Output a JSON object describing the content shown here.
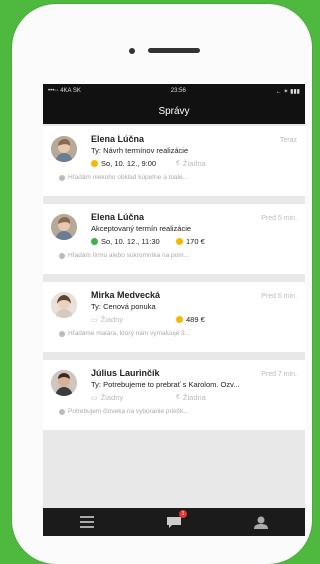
{
  "status_bar": {
    "carrier": "•••◦◦ 4KA SK",
    "time": "23:56",
    "right": "← ✶ ▮▮▮"
  },
  "nav": {
    "title": "Správy"
  },
  "messages": [
    {
      "name": "Elena Lúčna",
      "time": "Teraz",
      "subject": "Ty: Návrh termínov realizácie",
      "date": "So, 10. 12., 9:00",
      "date_status_color": "#f5b800",
      "price": "Žiadna",
      "price_muted": true,
      "preview": "Hľadám niekoho obklad kúpeľne a toale..."
    },
    {
      "name": "Elena Lúčna",
      "time": "Pred 5 min.",
      "subject": "Akceptovaný termín realizácie",
      "date": "So, 10. 12., 11:30",
      "date_status_color": "#3fb34a",
      "price": "170 €",
      "price_muted": false,
      "preview": "Hľadám firmu alebo súkromníka na pom..."
    },
    {
      "name": "Mirka Medvecká",
      "time": "Pred 6 min.",
      "subject": "Ty: Cenová ponuka",
      "date": "Žiadny",
      "date_status_color": "",
      "price": "489 €",
      "price_muted": false,
      "preview": "Hľadáme malára, ktorý nám vymalúuje 3..."
    },
    {
      "name": "Július Laurinčík",
      "time": "Pred 7 min.",
      "subject": "Ty: Potrebujeme to prebrať s Karolom. Ozv...",
      "date": "Žiadny",
      "date_status_color": "",
      "price": "Žiadna",
      "price_muted": true,
      "preview": "Potrebujem človeka na vybúranie priečk..."
    }
  ],
  "tabbar": {
    "tabs": [
      {
        "icon": "list-icon"
      },
      {
        "icon": "chat-icon",
        "badge": "1"
      },
      {
        "icon": "profile-icon"
      }
    ]
  },
  "colors": {
    "background": "#4fb83f",
    "accent_yellow": "#f5b800",
    "accent_green": "#3fb34a"
  }
}
